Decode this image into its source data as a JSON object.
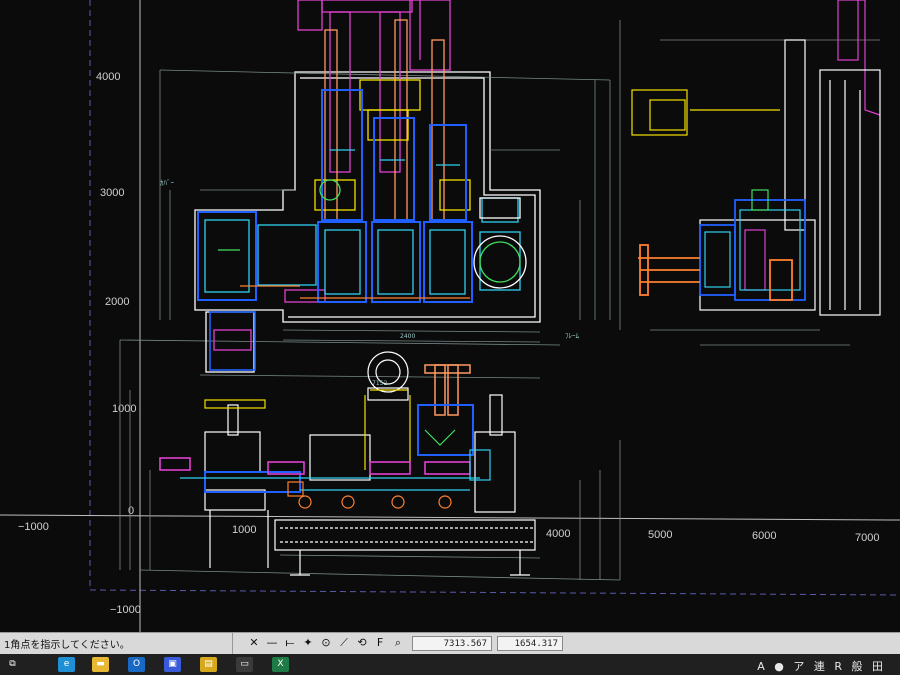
{
  "axes": {
    "y_labels": [
      "4000",
      "3000",
      "2000",
      "1000",
      "0",
      "−1000"
    ],
    "x_labels": [
      "−1000",
      "1000",
      "4000",
      "5000",
      "6000",
      "7000"
    ]
  },
  "drawing_notes": {
    "frame_label": "ﾌﾚｰﾑ",
    "cover_label": "ｶﾊﾞｰ",
    "dim_2400": "2400",
    "dim_7152": "7152"
  },
  "command_line": {
    "prompt": "1角点を指示してください。"
  },
  "toolbar": {
    "tools": [
      {
        "name": "cross-tool",
        "glyph": "✕"
      },
      {
        "name": "line-tool",
        "glyph": "—"
      },
      {
        "name": "polyline-tool",
        "glyph": "⟝"
      },
      {
        "name": "point-tool",
        "glyph": "✦"
      },
      {
        "name": "circle-tool",
        "glyph": "⊙"
      },
      {
        "name": "arc-tool",
        "glyph": "⟋"
      },
      {
        "name": "rotate-tool",
        "glyph": "⟲"
      },
      {
        "name": "font-tool",
        "glyph": "F"
      },
      {
        "name": "zoom-tool",
        "glyph": "⌕"
      }
    ]
  },
  "status": {
    "coord_x": "7313.567",
    "coord_y": "1654.317"
  },
  "taskbar": {
    "items": [
      {
        "name": "task-view-icon",
        "glyph": "⧉",
        "color": "#202020"
      },
      {
        "name": "edge-icon",
        "glyph": "e",
        "color": "#1f8fd6"
      },
      {
        "name": "file-explorer-icon",
        "glyph": "▬",
        "color": "#e8b832"
      },
      {
        "name": "outlook-icon",
        "glyph": "O",
        "color": "#1769c4"
      },
      {
        "name": "cad-app-icon",
        "glyph": "▣",
        "color": "#3a5bd9"
      },
      {
        "name": "notes-app-icon",
        "glyph": "▤",
        "color": "#d6a81c"
      },
      {
        "name": "terminal-icon",
        "glyph": "▭",
        "color": "#3a3a3a"
      },
      {
        "name": "excel-icon",
        "glyph": "X",
        "color": "#1e7b45"
      }
    ],
    "tray_text": "A ● ア 連 R 般 田"
  }
}
